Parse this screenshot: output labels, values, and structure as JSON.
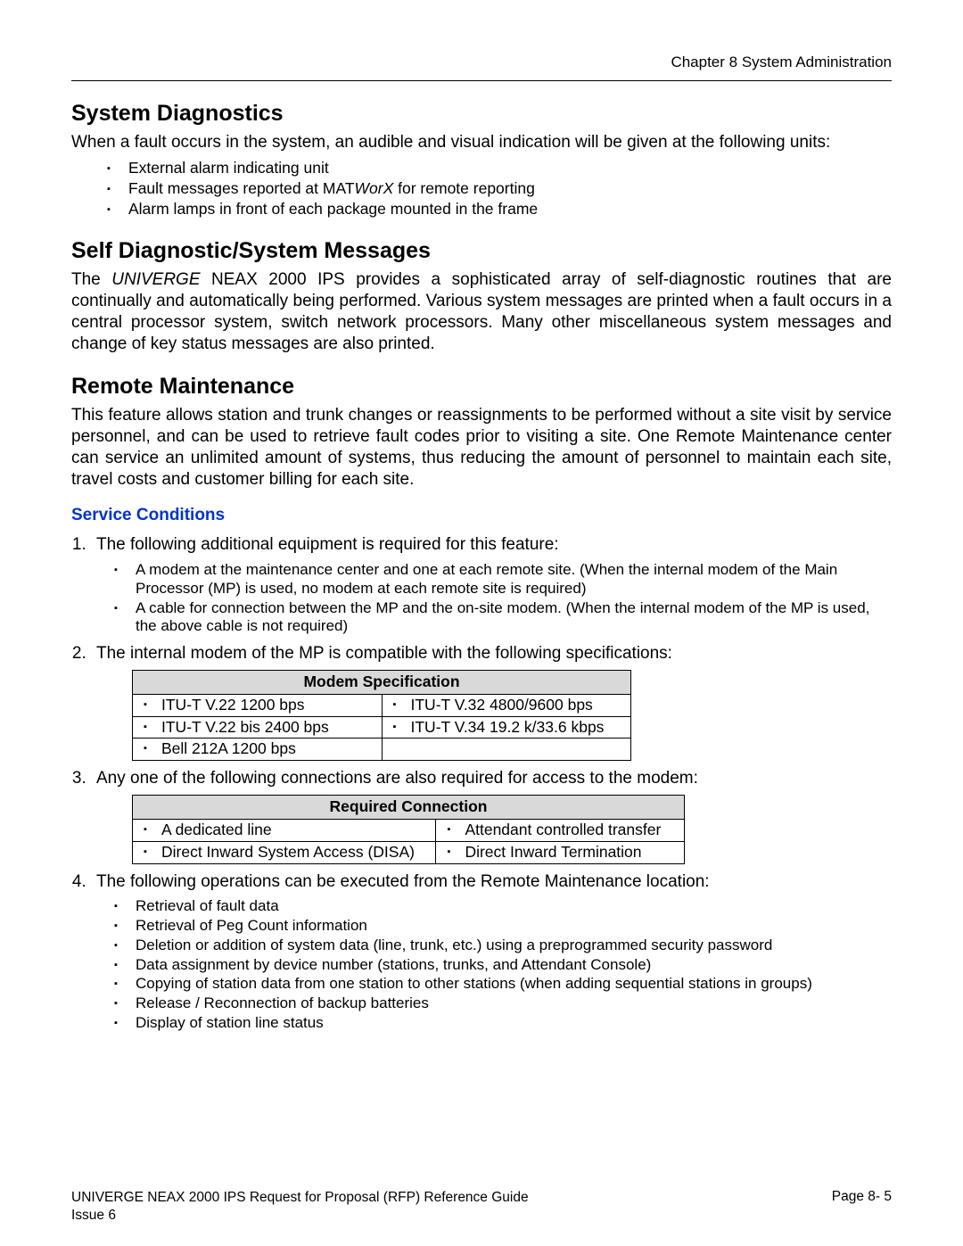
{
  "header": {
    "chapter": "Chapter 8   System Administration"
  },
  "sec1": {
    "title": "System Diagnostics",
    "intro": "When a fault occurs in the system, an audible and visual indication will be given at the following units:",
    "bullets": [
      "External alarm indicating unit",
      "Fault messages reported at MATWorX for remote reporting",
      "Alarm lamps in front of each package mounted in the frame"
    ]
  },
  "sec2": {
    "title": "Self Diagnostic/System Messages",
    "para_pre": "The ",
    "brand1": "UNIVERGE",
    "brand2": " NEAX",
    "para_post": " 2000 IPS provides a sophisticated array of self-diagnostic routines that are continually and automatically being performed. Various system messages are printed when a fault occurs in a central processor system, switch network processors. Many other miscellaneous system messages and change of key status messages are also printed."
  },
  "sec3": {
    "title": "Remote Maintenance",
    "para": "This feature allows station and trunk changes or reassignments to be performed without a site visit by service personnel, and can be used to retrieve fault codes prior to visiting a site. One Remote Maintenance center can service an unlimited amount of systems, thus reducing the amount of personnel to maintain each site, travel costs and customer billing for each site.",
    "svc_head": "Service Conditions",
    "li1": "The following additional equipment is required for this feature:",
    "li1_sub": [
      "A modem at the maintenance center and one at each remote site. (When the internal modem of the Main Processor (MP) is used, no modem at each remote site is required)",
      "A cable for connection between the MP and the on-site modem. (When the internal modem of the MP is used, the above cable is not required)"
    ],
    "li2": "The internal modem of the MP is compatible with the following specifications:",
    "table1": {
      "title": "Modem Specification",
      "rows": [
        [
          "ITU-T V.22 1200 bps",
          "ITU-T V.32 4800/9600 bps"
        ],
        [
          "ITU-T V.22 bis 2400 bps",
          "ITU-T V.34 19.2 k/33.6 kbps"
        ],
        [
          "Bell 212A 1200 bps",
          ""
        ]
      ]
    },
    "li3": "Any one of the following connections are also required for access to the modem:",
    "table2": {
      "title": "Required Connection",
      "rows": [
        [
          "A dedicated line",
          "Attendant controlled transfer"
        ],
        [
          "Direct Inward System Access (DISA)",
          "Direct Inward Termination"
        ]
      ]
    },
    "li4": "The following operations can be executed from the Remote Maintenance location:",
    "li4_sub": [
      "Retrieval of fault data",
      "Retrieval of Peg Count information",
      "Deletion or addition of system data (line, trunk, etc.) using a preprogrammed security password",
      "Data assignment by device number (stations, trunks, and Attendant Console)",
      "Copying of station data from one station to other stations (when adding sequential stations in groups)",
      "Release / Reconnection of backup batteries",
      "Display of station line status"
    ]
  },
  "footer": {
    "title_pre": "UNIVERGE ",
    "title_sc": "NEAX",
    "title_post": " 2000 IPS Request for Proposal (RFP) Reference Guide",
    "issue": "Issue 6",
    "page": "Page 8- 5"
  }
}
